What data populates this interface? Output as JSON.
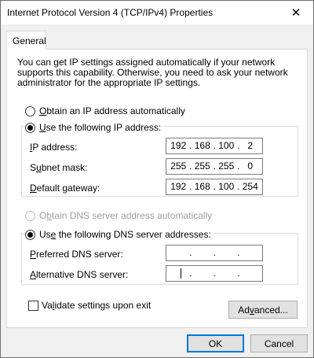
{
  "window": {
    "title": "Internet Protocol Version 4 (TCP/IPv4) Properties",
    "close_glyph": "✕"
  },
  "tabs": [
    {
      "label": "General",
      "selected": true
    }
  ],
  "intro_text": "You can get IP settings assigned automatically if your network supports this capability. Otherwise, you need to ask your network administrator for the appropriate IP settings.",
  "ip_section": {
    "auto_radio": {
      "mnemonic": "O",
      "rest": "btain an IP address automatically",
      "checked": false
    },
    "manual_radio": {
      "mnemonic": "U",
      "rest": "se the following IP address:",
      "checked": true
    },
    "fields": [
      {
        "pre": "",
        "mnemonic": "I",
        "post": "P address:",
        "octets": [
          "192",
          "168",
          "100",
          "2"
        ]
      },
      {
        "pre": "S",
        "mnemonic": "u",
        "post": "bnet mask:",
        "octets": [
          "255",
          "255",
          "255",
          "0"
        ]
      },
      {
        "pre": "",
        "mnemonic": "D",
        "post": "efault gateway:",
        "octets": [
          "192",
          "168",
          "100",
          "254"
        ]
      }
    ]
  },
  "dns_section": {
    "auto_radio": {
      "pre": "O",
      "mnemonic": "b",
      "post": "tain DNS server address automatically",
      "checked": false,
      "disabled": true
    },
    "manual_radio": {
      "pre": "Us",
      "mnemonic": "e",
      "post": " the following DNS server addresses:",
      "checked": true
    },
    "fields": [
      {
        "mnemonic": "P",
        "post": "referred DNS server:",
        "octets": [
          "",
          "",
          "",
          ""
        ]
      },
      {
        "mnemonic": "A",
        "post": "lternative DNS server:",
        "octets": [
          "",
          "",
          "",
          ""
        ]
      }
    ]
  },
  "validate_checkbox": {
    "pre": "Va",
    "mnemonic": "l",
    "post": "idate settings upon exit",
    "checked": false
  },
  "buttons": {
    "advanced": {
      "pre": "Ad",
      "mnemonic": "v",
      "post": "anced..."
    },
    "ok": "OK",
    "cancel": "Cancel"
  },
  "colors": {
    "focus_border": "#0078d7",
    "dialog_bg": "#f0f0f0",
    "disabled_text": "#a0a0a0"
  }
}
